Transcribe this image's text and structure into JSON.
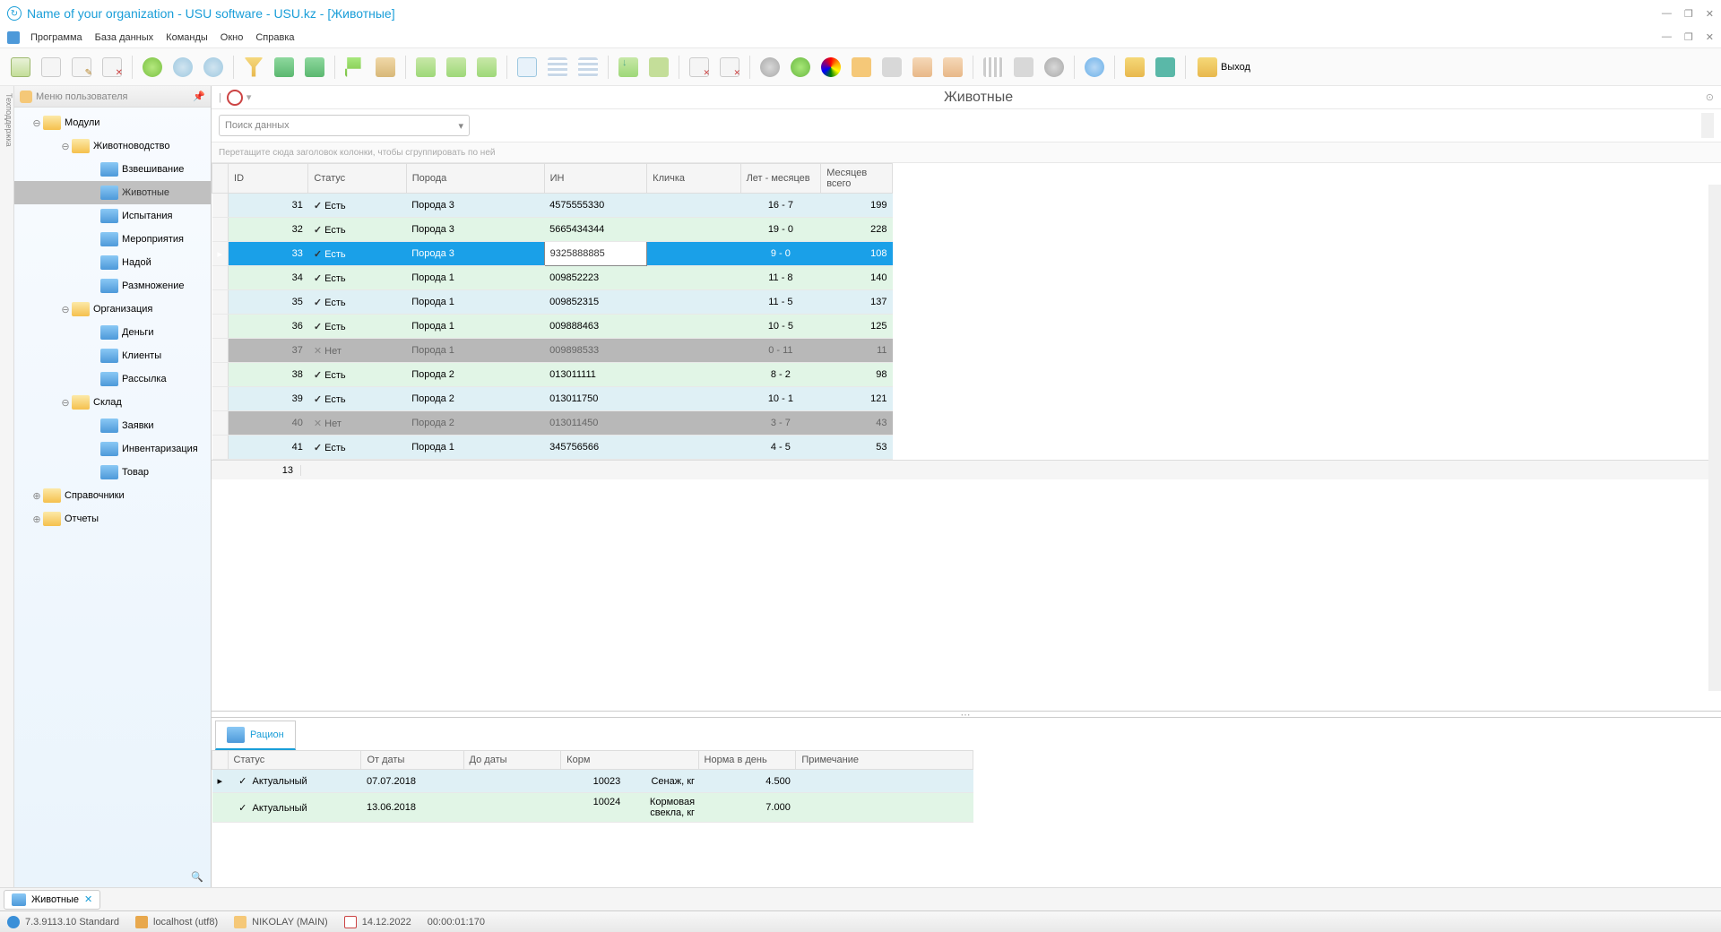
{
  "window": {
    "title": "Name of your organization - USU software - USU.kz - [Животные]"
  },
  "menubar": {
    "items": [
      "Программа",
      "База данных",
      "Команды",
      "Окно",
      "Справка"
    ]
  },
  "toolbar": {
    "exit_label": "Выход"
  },
  "sidebar": {
    "vertical_label": "Техподдержка",
    "header": "Меню пользователя",
    "nodes": [
      {
        "level": 1,
        "type": "folder-open",
        "label": "Модули",
        "exp": "⊖"
      },
      {
        "level": 2,
        "type": "folder-open",
        "label": "Животноводство",
        "exp": "⊖"
      },
      {
        "level": 3,
        "type": "book",
        "label": "Взвешивание"
      },
      {
        "level": 3,
        "type": "book",
        "label": "Животные",
        "selected": true
      },
      {
        "level": 3,
        "type": "book",
        "label": "Испытания"
      },
      {
        "level": 3,
        "type": "book",
        "label": "Мероприятия"
      },
      {
        "level": 3,
        "type": "book",
        "label": "Надой"
      },
      {
        "level": 3,
        "type": "book",
        "label": "Размножение"
      },
      {
        "level": 2,
        "type": "folder-open",
        "label": "Организация",
        "exp": "⊖"
      },
      {
        "level": 3,
        "type": "book",
        "label": "Деньги"
      },
      {
        "level": 3,
        "type": "book",
        "label": "Клиенты"
      },
      {
        "level": 3,
        "type": "book",
        "label": "Рассылка"
      },
      {
        "level": 2,
        "type": "folder-open",
        "label": "Склад",
        "exp": "⊖"
      },
      {
        "level": 3,
        "type": "book",
        "label": "Заявки"
      },
      {
        "level": 3,
        "type": "book",
        "label": "Инвентаризация"
      },
      {
        "level": 3,
        "type": "book",
        "label": "Товар"
      },
      {
        "level": 1,
        "type": "folder",
        "label": "Справочники",
        "exp": "⊕"
      },
      {
        "level": 1,
        "type": "folder",
        "label": "Отчеты",
        "exp": "⊕"
      }
    ]
  },
  "content": {
    "title": "Животные",
    "search_placeholder": "Поиск данных",
    "group_hint": "Перетащите сюда заголовок колонки, чтобы сгруппировать по ней",
    "columns": [
      "ID",
      "Статус",
      "Порода",
      "ИН",
      "Кличка",
      "Лет - месяцев",
      "Месяцев всего"
    ],
    "rows": [
      {
        "cls": "r-blue",
        "id": "31",
        "status": "Есть",
        "ok": true,
        "breed": "Порода 3",
        "in": "4575555330",
        "nick": "",
        "age": "16 - 7",
        "months": "199"
      },
      {
        "cls": "r-green",
        "id": "32",
        "status": "Есть",
        "ok": true,
        "breed": "Порода 3",
        "in": "5665434344",
        "nick": "",
        "age": "19 - 0",
        "months": "228"
      },
      {
        "cls": "r-sel",
        "id": "33",
        "status": "Есть",
        "ok": true,
        "breed": "Порода 3",
        "in": "9325888885",
        "nick": "",
        "age": "9 - 0",
        "months": "108",
        "selected": true,
        "focus_col": "in"
      },
      {
        "cls": "r-green",
        "id": "34",
        "status": "Есть",
        "ok": true,
        "breed": "Порода 1",
        "in": "009852223",
        "nick": "",
        "age": "11 - 8",
        "months": "140"
      },
      {
        "cls": "r-blue",
        "id": "35",
        "status": "Есть",
        "ok": true,
        "breed": "Порода 1",
        "in": "009852315",
        "nick": "",
        "age": "11 - 5",
        "months": "137"
      },
      {
        "cls": "r-green",
        "id": "36",
        "status": "Есть",
        "ok": true,
        "breed": "Порода 1",
        "in": "009888463",
        "nick": "",
        "age": "10 - 5",
        "months": "125"
      },
      {
        "cls": "r-gray",
        "id": "37",
        "status": "Нет",
        "ok": false,
        "breed": "Порода 1",
        "in": "009898533",
        "nick": "",
        "age": "0 - 11",
        "months": "11"
      },
      {
        "cls": "r-green",
        "id": "38",
        "status": "Есть",
        "ok": true,
        "breed": "Порода 2",
        "in": "013011111",
        "nick": "",
        "age": "8 - 2",
        "months": "98"
      },
      {
        "cls": "r-blue",
        "id": "39",
        "status": "Есть",
        "ok": true,
        "breed": "Порода 2",
        "in": "013011750",
        "nick": "",
        "age": "10 - 1",
        "months": "121"
      },
      {
        "cls": "r-gray",
        "id": "40",
        "status": "Нет",
        "ok": false,
        "breed": "Порода 2",
        "in": "013011450",
        "nick": "",
        "age": "3 - 7",
        "months": "43"
      },
      {
        "cls": "r-blue",
        "id": "41",
        "status": "Есть",
        "ok": true,
        "breed": "Порода 1",
        "in": "345756566",
        "nick": "",
        "age": "4 - 5",
        "months": "53"
      }
    ],
    "row_count": "13"
  },
  "detail": {
    "tab_label": "Рацион",
    "columns": [
      "Статус",
      "От даты",
      "До даты",
      "Корм",
      "Норма в день",
      "Примечание"
    ],
    "rows": [
      {
        "cls": "r-blue",
        "status": "Актуальный",
        "from": "07.07.2018",
        "to": "",
        "feed_id": "10023",
        "feed": "Сенаж, кг",
        "norm": "4.500",
        "note": "",
        "ind": "▸"
      },
      {
        "cls": "r-green",
        "status": "Актуальный",
        "from": "13.06.2018",
        "to": "",
        "feed_id": "10024",
        "feed": "Кормовая свекла, кг",
        "norm": "7.000",
        "note": ""
      }
    ]
  },
  "tabs": {
    "open": [
      {
        "label": "Животные"
      }
    ]
  },
  "statusbar": {
    "version": "7.3.9113.10 Standard",
    "host": "localhost (utf8)",
    "user": "NIKOLAY (MAIN)",
    "date": "14.12.2022",
    "time": "00:00:01:170"
  }
}
